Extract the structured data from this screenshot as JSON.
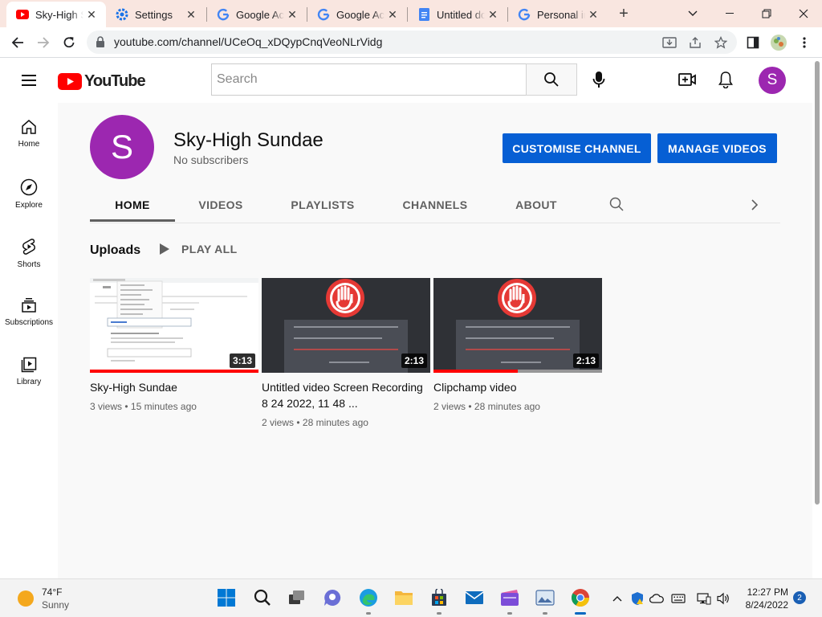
{
  "browser": {
    "tabs": [
      {
        "title": "Sky-High Sundae",
        "favicon": "youtube-icon",
        "active": true
      },
      {
        "title": "Settings",
        "favicon": "settings-gear-icon",
        "active": false
      },
      {
        "title": "Google Account",
        "favicon": "google-icon",
        "active": false
      },
      {
        "title": "Google Account",
        "favicon": "google-icon",
        "active": false
      },
      {
        "title": "Untitled document",
        "favicon": "docs-icon",
        "active": false
      },
      {
        "title": "Personal info",
        "favicon": "google-icon",
        "active": false
      }
    ],
    "new_tab_label": "+",
    "address": "youtube.com/channel/UCeOq_xDQypCnqVeoNLrVidg",
    "colors": {
      "tabstrip": "#f9e6e0",
      "youtube_red": "#ff0000"
    }
  },
  "youtube": {
    "logo_text": "YouTube",
    "search_placeholder": "Search",
    "user_initial": "S",
    "colors": {
      "avatar": "#9c27b0",
      "primary_button": "#065fd4"
    }
  },
  "sidebar": {
    "items": [
      {
        "label": "Home",
        "icon": "home-icon"
      },
      {
        "label": "Explore",
        "icon": "compass-icon"
      },
      {
        "label": "Shorts",
        "icon": "shorts-icon"
      },
      {
        "label": "Subscriptions",
        "icon": "subscriptions-icon"
      },
      {
        "label": "Library",
        "icon": "library-icon"
      }
    ]
  },
  "channel": {
    "avatar_initial": "S",
    "name": "Sky-High Sundae",
    "subscribers": "No subscribers",
    "customise_button": "CUSTOMISE CHANNEL",
    "manage_button": "MANAGE VIDEOS",
    "tabs": [
      "HOME",
      "VIDEOS",
      "PLAYLISTS",
      "CHANNELS",
      "ABOUT"
    ],
    "active_tab": "HOME"
  },
  "uploads": {
    "section_title": "Uploads",
    "play_all_label": "PLAY ALL",
    "videos": [
      {
        "title": "Sky-High Sundae",
        "views": "3 views",
        "age": "15 minutes ago",
        "duration": "3:13",
        "watched_fraction": 1.0,
        "thumb_style": "document-screenshot"
      },
      {
        "title": "Untitled video Screen Recording 8 24 2022, 11 48 ...",
        "views": "2 views",
        "age": "28 minutes ago",
        "duration": "2:13",
        "watched_fraction": 0.0,
        "thumb_style": "blocked-page"
      },
      {
        "title": "Clipchamp video",
        "views": "2 views",
        "age": "28 minutes ago",
        "duration": "2:13",
        "watched_fraction": 0.5,
        "thumb_style": "blocked-page"
      }
    ]
  },
  "taskbar": {
    "weather": {
      "temp": "74°F",
      "condition": "Sunny"
    },
    "apps": [
      "windows-start-icon",
      "search-icon",
      "task-view-icon",
      "chat-icon",
      "edge-icon",
      "file-explorer-icon",
      "store-icon",
      "mail-icon",
      "clipchamp-icon",
      "photos-icon",
      "chrome-icon"
    ],
    "time": "12:27 PM",
    "date": "8/24/2022",
    "notification_count": "2"
  }
}
